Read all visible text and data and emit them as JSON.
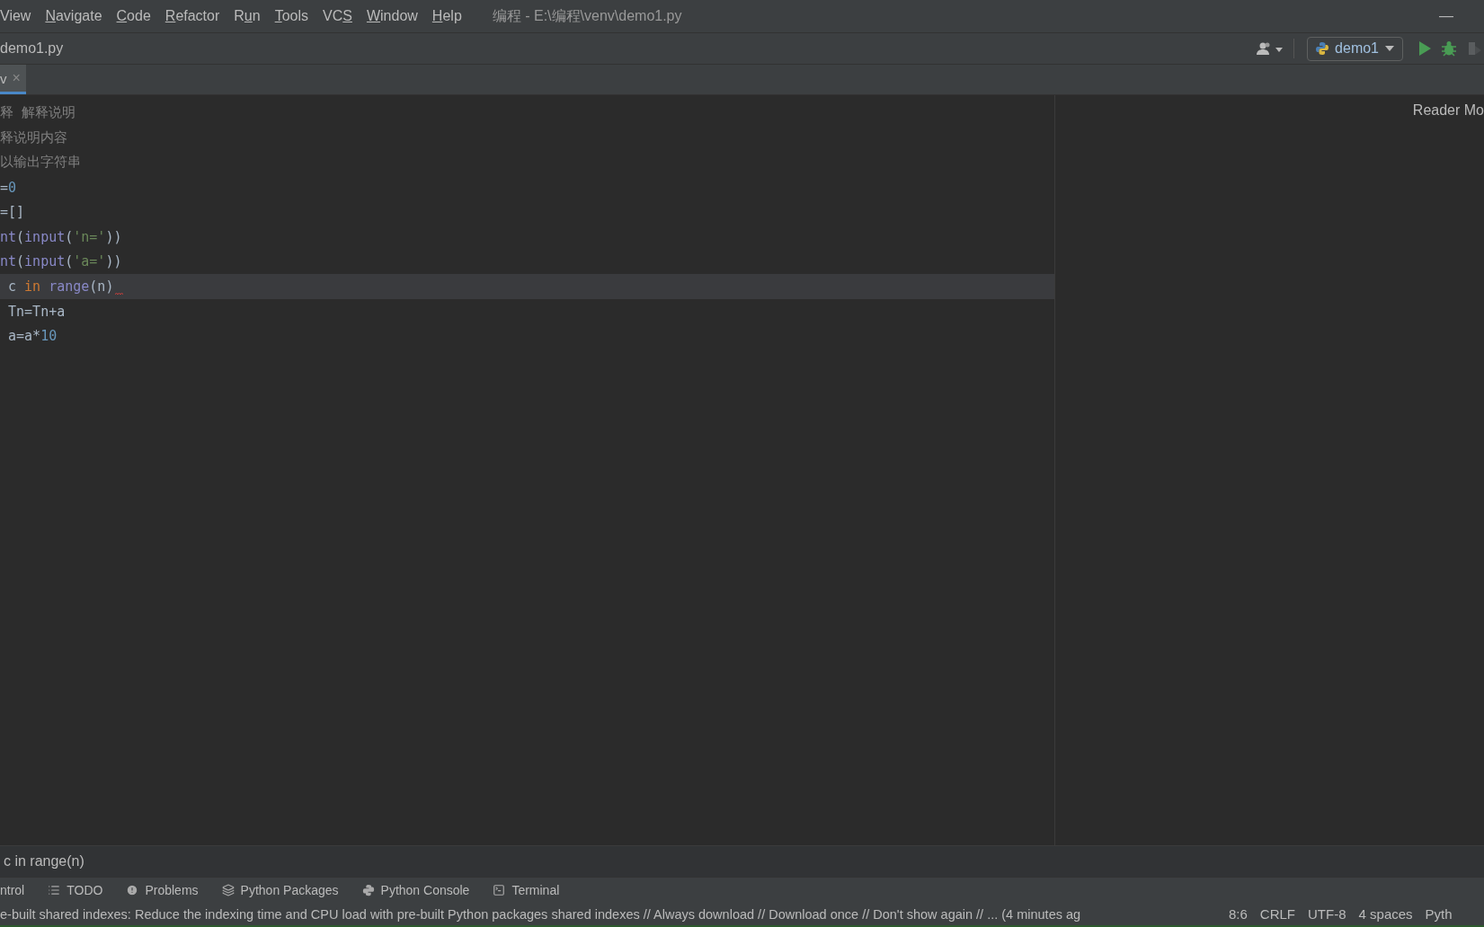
{
  "menu": [
    {
      "pre": "View"
    },
    {
      "key": "N",
      "post": "avigate"
    },
    {
      "key": "C",
      "post": "ode"
    },
    {
      "key": "R",
      "post": "efactor"
    },
    {
      "pre": "R",
      "key": "u",
      "post": "n"
    },
    {
      "key": "T",
      "post": "ools"
    },
    {
      "pre": "VC",
      "key": "S"
    },
    {
      "key": "W",
      "post": "indow"
    },
    {
      "key": "H",
      "post": "elp"
    }
  ],
  "window": {
    "title": "编程 - E:\\编程\\venv\\demo1.py",
    "minimize": "—"
  },
  "breadcrumb": {
    "file": "demo1.py"
  },
  "run_config": {
    "name": "demo1"
  },
  "tabs": [
    {
      "label": "v",
      "selected": true,
      "close": "×"
    }
  ],
  "reader_mode": "Reader Mo",
  "code_lines": [
    {
      "current": false,
      "error": false,
      "tokens": [
        {
          "kind": "comment",
          "text": "释 解释说明"
        }
      ]
    },
    {
      "current": false,
      "error": false,
      "tokens": [
        {
          "kind": "comment",
          "text": "释说明内容"
        }
      ]
    },
    {
      "current": false,
      "error": false,
      "tokens": [
        {
          "kind": "comment",
          "text": "以输出字符串"
        }
      ]
    },
    {
      "current": false,
      "error": false,
      "tokens": [
        {
          "kind": "plain",
          "text": "="
        },
        {
          "kind": "number",
          "text": "0"
        }
      ]
    },
    {
      "current": false,
      "error": false,
      "tokens": [
        {
          "kind": "plain",
          "text": "=[]"
        }
      ]
    },
    {
      "current": false,
      "error": false,
      "tokens": [
        {
          "kind": "builtin",
          "text": "nt"
        },
        {
          "kind": "plain",
          "text": "("
        },
        {
          "kind": "builtin",
          "text": "input"
        },
        {
          "kind": "plain",
          "text": "("
        },
        {
          "kind": "string",
          "text": "'n='"
        },
        {
          "kind": "plain",
          "text": "))"
        }
      ]
    },
    {
      "current": false,
      "error": false,
      "tokens": [
        {
          "kind": "builtin",
          "text": "nt"
        },
        {
          "kind": "plain",
          "text": "("
        },
        {
          "kind": "builtin",
          "text": "input"
        },
        {
          "kind": "plain",
          "text": "("
        },
        {
          "kind": "string",
          "text": "'a='"
        },
        {
          "kind": "plain",
          "text": "))"
        }
      ]
    },
    {
      "current": true,
      "error": true,
      "tokens": [
        {
          "kind": "plain",
          "text": " c "
        },
        {
          "kind": "keyword",
          "text": "in"
        },
        {
          "kind": "builtin",
          "text": " range"
        },
        {
          "kind": "plain",
          "text": "(n)"
        }
      ]
    },
    {
      "current": false,
      "error": false,
      "tokens": [
        {
          "kind": "plain",
          "text": " Tn=Tn+a"
        }
      ]
    },
    {
      "current": false,
      "error": false,
      "tokens": [
        {
          "kind": "plain",
          "text": " a=a*"
        },
        {
          "kind": "number",
          "text": "10"
        }
      ]
    }
  ],
  "code_breadcrumb": "c in range(n)",
  "tool_windows": [
    {
      "kind": "none",
      "label": "ntrol"
    },
    {
      "kind": "todo",
      "label": "TODO"
    },
    {
      "kind": "problems",
      "label": "Problems"
    },
    {
      "kind": "packages",
      "label": "Python Packages"
    },
    {
      "kind": "console",
      "label": "Python Console"
    },
    {
      "kind": "terminal",
      "label": "Terminal"
    }
  ],
  "status_bar": {
    "message": "e-built shared indexes: Reduce the indexing time and CPU load with pre-built Python packages shared indexes // Always download // Download once // Don't show again // ... (4 minutes ag",
    "items": [
      "8:6",
      "CRLF",
      "UTF-8",
      "4 spaces",
      "Pyth"
    ]
  }
}
